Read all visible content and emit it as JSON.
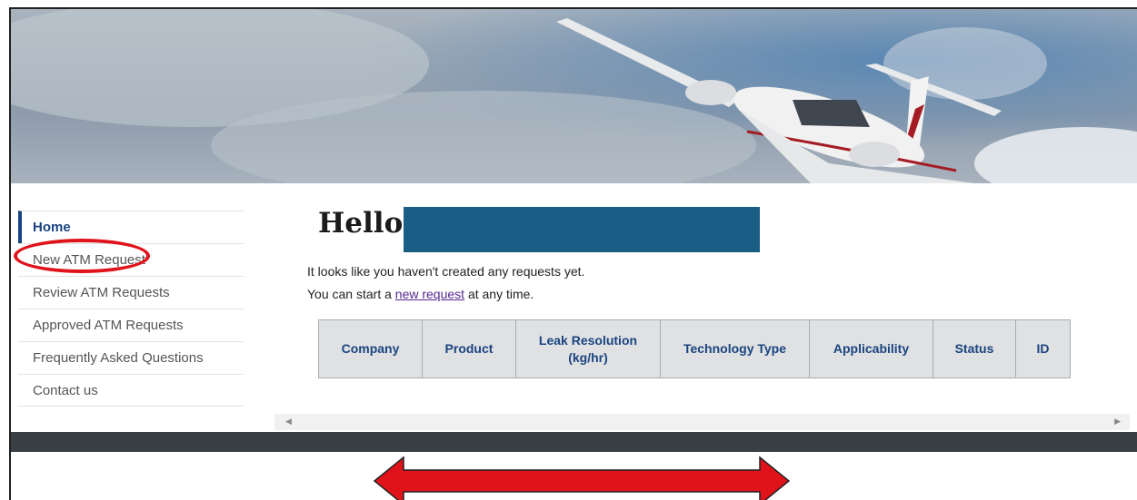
{
  "sidebar": {
    "items": [
      {
        "label": "Home"
      },
      {
        "label": "New ATM Request"
      },
      {
        "label": "Review ATM Requests"
      },
      {
        "label": "Approved ATM Requests"
      },
      {
        "label": "Frequently Asked Questions"
      },
      {
        "label": "Contact us"
      }
    ]
  },
  "main": {
    "greeting": "Hello,",
    "line1": "It looks like you haven't created any requests yet.",
    "line2_before": "You can start a ",
    "line2_link": "new request",
    "line2_after": " at any time.",
    "table_headers": [
      "Company",
      "Product",
      "Leak Resolution\n(kg/hr)",
      "Technology Type",
      "Applicability",
      "Status",
      "ID"
    ]
  },
  "scroll": {
    "left_glyph": "◀",
    "right_glyph": "▶"
  },
  "colors": {
    "accent": "#1a4480",
    "redaction": "#1b5e85",
    "annotation": "#e0131b",
    "footer_bar": "#3a3f46"
  }
}
